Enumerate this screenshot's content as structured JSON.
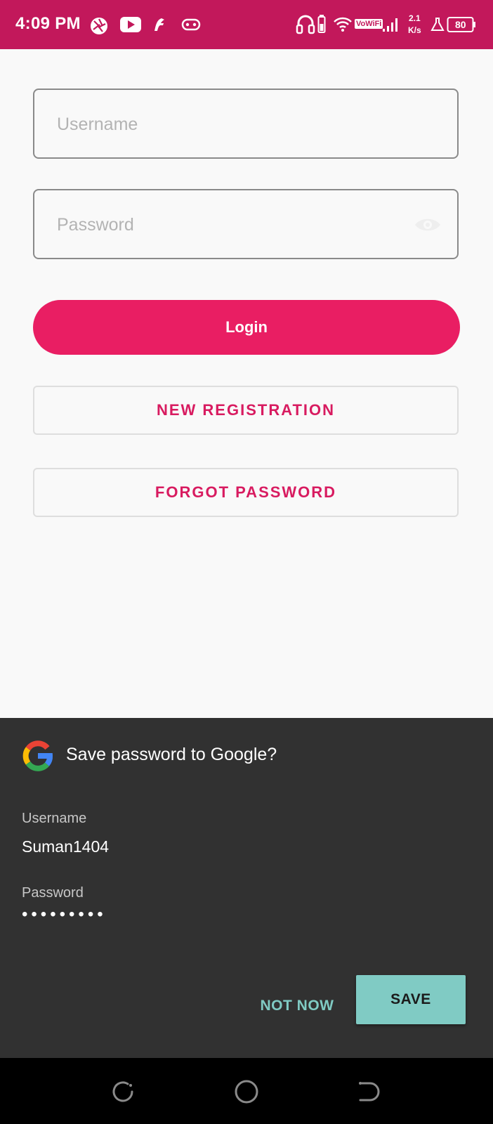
{
  "status_bar": {
    "time": "4:09 PM",
    "network_label": "VoWiFi",
    "speed_value": "2.1",
    "speed_unit": "K/s",
    "battery": "80",
    "background_color": "#c2185b",
    "icons": [
      "shutter-icon",
      "youtube-icon",
      "flash-icon",
      "gamepad-icon",
      "headphones-icon",
      "battery-saver-icon",
      "wifi-icon",
      "signal-icon",
      "flask-icon",
      "battery-icon"
    ]
  },
  "login_form": {
    "username_placeholder": "Username",
    "username_value": "",
    "password_placeholder": "Password",
    "password_value": "",
    "password_toggle_icon": "eye-icon",
    "login_label": "Login",
    "new_registration_label": "NEW REGISTRATION",
    "forgot_password_label": "FORGOT PASSWORD",
    "accent_color": "#e91e63"
  },
  "save_password_sheet": {
    "logo_icon": "google-logo",
    "title": "Save password to Google?",
    "username_label": "Username",
    "username_value": "Suman1404",
    "password_label": "Password",
    "password_mask": "•••••••••",
    "not_now_label": "NOT NOW",
    "save_label": "SAVE",
    "accent_color": "#80cbc4"
  },
  "navigation_bar": {
    "icons": [
      "recents-icon",
      "home-icon",
      "back-icon"
    ]
  }
}
